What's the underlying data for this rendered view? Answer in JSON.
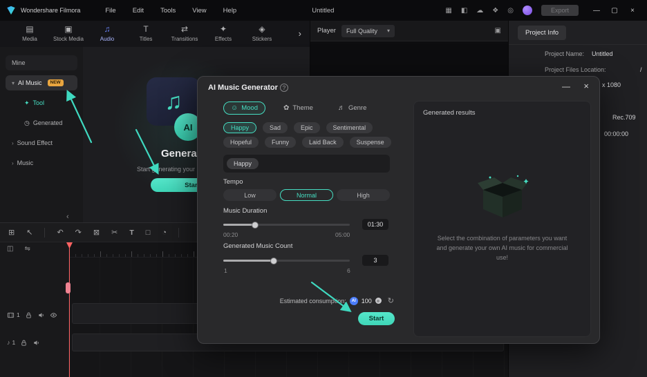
{
  "titlebar": {
    "app_name": "Wondershare Filmora",
    "menus": [
      "File",
      "Edit",
      "Tools",
      "View",
      "Help"
    ],
    "document_title": "Untitled",
    "icons": [
      {
        "name": "layout-icon",
        "glyph": "▦"
      },
      {
        "name": "snapshot-icon",
        "glyph": "◧"
      },
      {
        "name": "cloud-upload-icon",
        "glyph": "☁"
      },
      {
        "name": "plugins-icon",
        "glyph": "❖"
      },
      {
        "name": "notifications-icon",
        "glyph": "◎"
      }
    ],
    "export_label": "Export",
    "window_controls": {
      "minimize": "—",
      "maximize": "▢",
      "close": "×"
    }
  },
  "media_tabs": {
    "overflow_icon": "›",
    "items": [
      {
        "label": "Media",
        "icon": "▤"
      },
      {
        "label": "Stock Media",
        "icon": "▣"
      },
      {
        "label": "Audio",
        "icon": "♫"
      },
      {
        "label": "Titles",
        "icon": "T"
      },
      {
        "label": "Transitions",
        "icon": "⇄"
      },
      {
        "label": "Effects",
        "icon": "✦"
      },
      {
        "label": "Stickers",
        "icon": "◈"
      }
    ]
  },
  "sidebar": {
    "items": [
      {
        "label": "Mine"
      },
      {
        "label": "AI Music",
        "chevron": "▾",
        "badge": "NEW"
      },
      {
        "label": "Tool",
        "icon": "✦"
      },
      {
        "label": "Generated",
        "icon": "◷"
      },
      {
        "label": "Sound Effect",
        "chevron": "›"
      },
      {
        "label": "Music",
        "chevron": "›"
      }
    ],
    "collapse_icon": "‹"
  },
  "content_promo": {
    "note_icon": "♫",
    "ai_badge": "AI",
    "title": "Generate",
    "subtitle": "Start generating your",
    "start_label": "Start"
  },
  "player": {
    "label": "Player",
    "quality_value": "Full Quality",
    "dropdown_icon": "▾",
    "panel_icon": "▣"
  },
  "project_info": {
    "tab_label": "Project Info",
    "name_label": "Project Name:",
    "name_value": "Untitled",
    "location_label": "Project Files Location:",
    "location_value": "/",
    "resolution_partial": "x 1080",
    "color_space": "Rec.709",
    "timecode": "00:00:00"
  },
  "modal": {
    "title": "AI Music Generator",
    "help_icon": "?",
    "minimize_icon": "—",
    "close_icon": "×",
    "tabs": [
      {
        "label": "Mood",
        "icon": "☺"
      },
      {
        "label": "Theme",
        "icon": "✿"
      },
      {
        "label": "Genre",
        "icon": "♬"
      }
    ],
    "moods": [
      "Happy",
      "Sad",
      "Epic",
      "Sentimental",
      "Hopeful",
      "Funny",
      "Laid Back",
      "Suspense"
    ],
    "selected_mood": "Happy",
    "tempo_label": "Tempo",
    "tempo_options": [
      "Low",
      "Normal",
      "High"
    ],
    "duration_label": "Music Duration",
    "duration_min": "00:20",
    "duration_max": "05:00",
    "duration_value": "01:30",
    "count_label": "Generated Music Count",
    "count_min": "1",
    "count_max": "6",
    "count_value": "3",
    "consumption_label": "Estimated consumption:",
    "ai_badge": "AI",
    "consumption_value": "100",
    "refresh_icon": "↻",
    "start_label": "Start",
    "results_title": "Generated results",
    "empty_text": "Select the combination of parameters you want and generate your own AI music for commercial use!"
  },
  "timeline": {
    "tools": [
      {
        "name": "snap",
        "icon": "⊞"
      },
      {
        "name": "select",
        "icon": "↖"
      },
      {
        "name": "undo",
        "icon": "↶"
      },
      {
        "name": "redo",
        "icon": "↷"
      },
      {
        "name": "delete",
        "icon": "⊠"
      },
      {
        "name": "split",
        "icon": "✂"
      },
      {
        "name": "text",
        "icon": "T"
      },
      {
        "name": "crop",
        "icon": "□"
      },
      {
        "name": "speed",
        "icon": "◔"
      }
    ],
    "subtools": [
      {
        "name": "copy",
        "icon": "◫"
      },
      {
        "name": "link",
        "icon": "⇋"
      }
    ],
    "video_track_number": "1",
    "audio_track_number": "1",
    "audio_note_icon": "♪"
  },
  "colors": {
    "accent": "#46dfc3",
    "audio_blue": "#6d87ff"
  }
}
